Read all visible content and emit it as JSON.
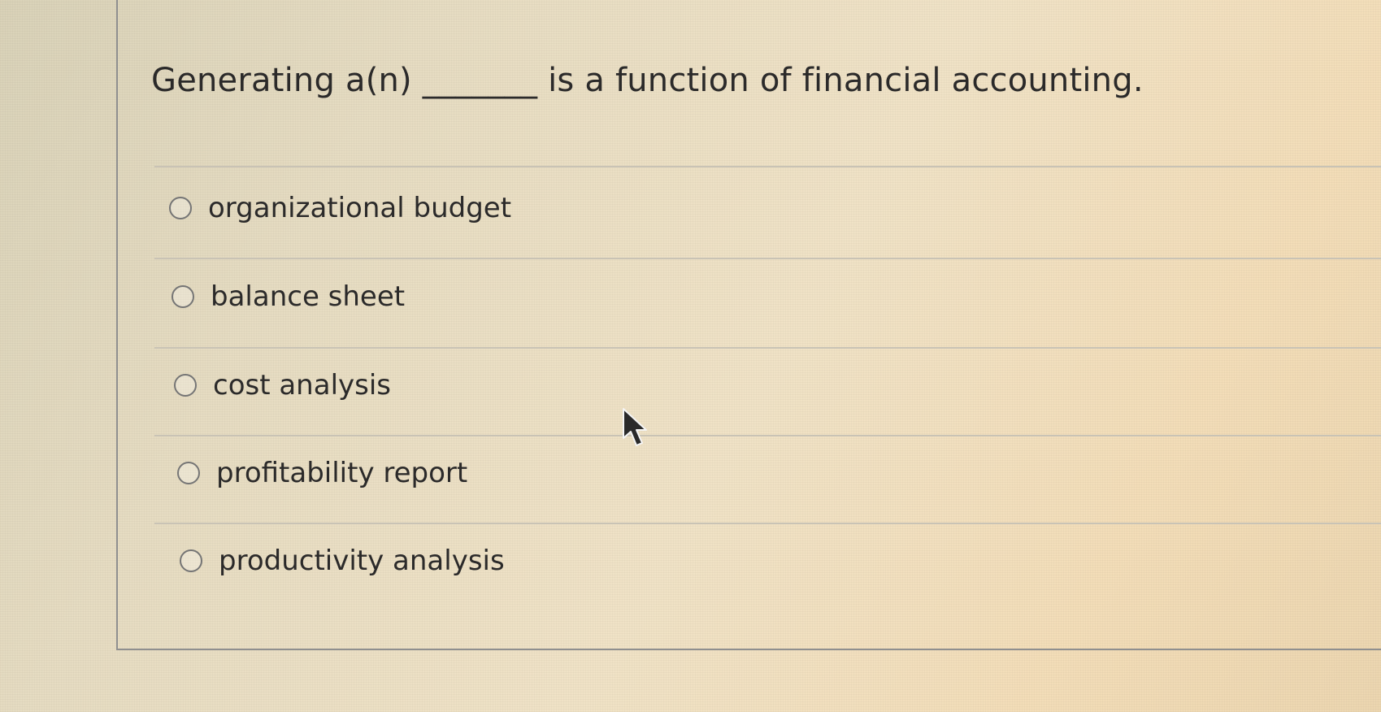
{
  "question": {
    "text": "Generating a(n) _______ is a function of financial accounting."
  },
  "options": [
    {
      "label": "organizational budget"
    },
    {
      "label": "balance sheet"
    },
    {
      "label": "cost analysis"
    },
    {
      "label": "profitability report"
    },
    {
      "label": "productivity analysis"
    }
  ],
  "cursor": {
    "icon": "arrow-pointer-icon"
  },
  "colors": {
    "text": "#2b2a2a",
    "radio_border": "#757575",
    "divider": "#c9c3b5",
    "card_border": "#8f8f8f"
  }
}
